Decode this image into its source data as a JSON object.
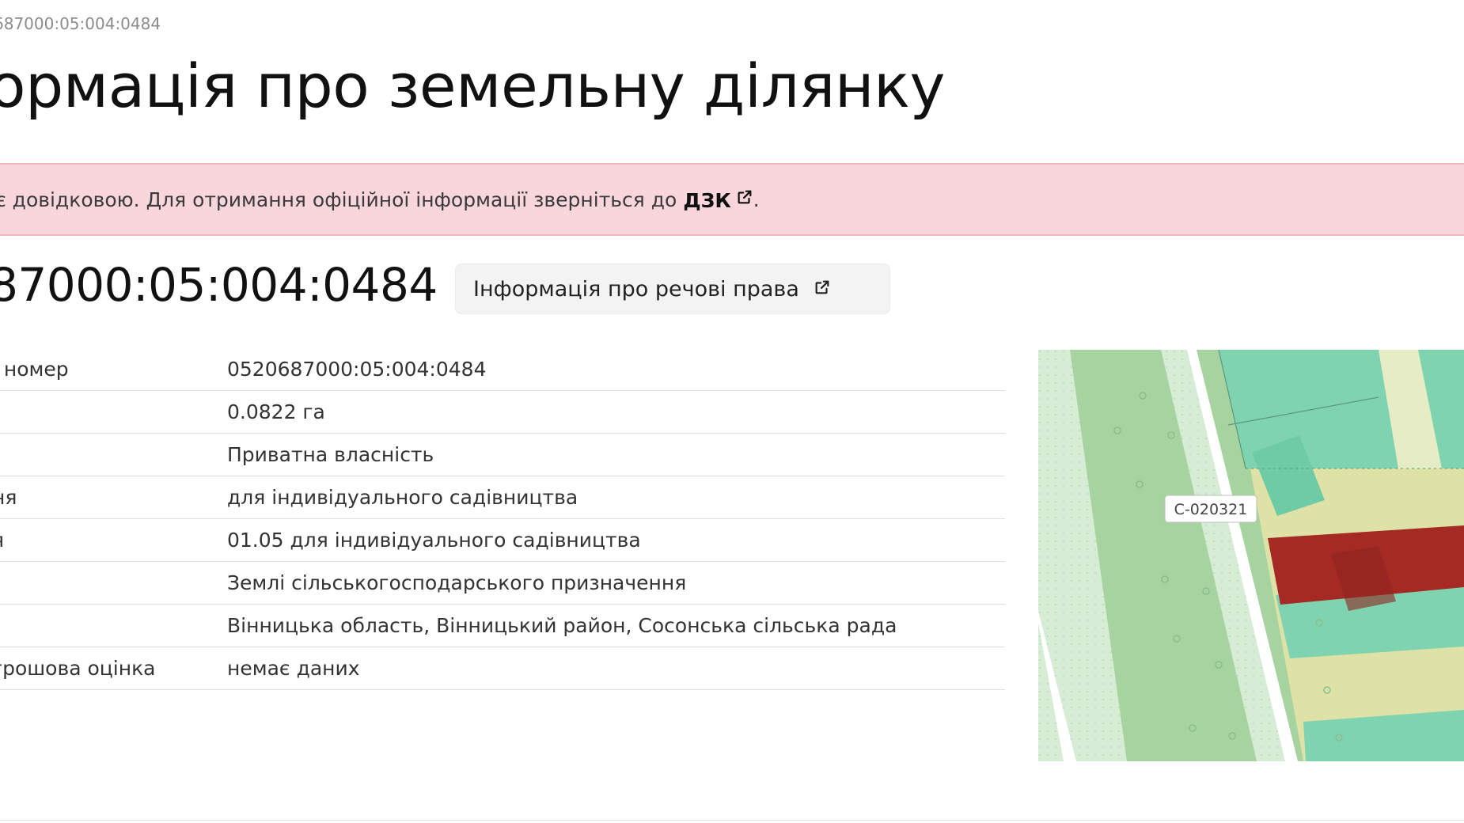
{
  "breadcrumb": "687000:05:004:0484",
  "page_title": "ормація про земельну ділянку",
  "notice": {
    "text": "є довідковою. Для отримання офіційної інформації зверніться до",
    "link_label": "ДЗК",
    "trailing": "."
  },
  "cadastral_header": "87000:05:004:0484",
  "rights_button_label": "Інформація про речові права",
  "rows": [
    {
      "label": "і номер",
      "value": "0520687000:05:004:0484"
    },
    {
      "label": "",
      "value": "0.0822 га"
    },
    {
      "label": "",
      "value": "Приватна власність"
    },
    {
      "label": "ня",
      "value": "для індивідуального садівництва"
    },
    {
      "label": "я",
      "value": "01.05 для індивідуального садівництва"
    },
    {
      "label": "",
      "value": "Землі сільськогосподарського призначення"
    },
    {
      "label": "",
      "value": "Вінницька область, Вінницький район, Сосонська сільська рада"
    },
    {
      "label": "грошова оцінка",
      "value": "немає даних"
    }
  ],
  "map": {
    "road_label": "С-020321",
    "colors": {
      "parcel_highlight": "#a52a24",
      "green_zone": "#7fd3b0",
      "yellow_zone": "#dfe2a6",
      "light_green": "#cfe8c8",
      "road": "#ffffff"
    }
  },
  "colors": {
    "notice_bg": "#f8d6dc",
    "button_bg": "#f3f3f3"
  }
}
